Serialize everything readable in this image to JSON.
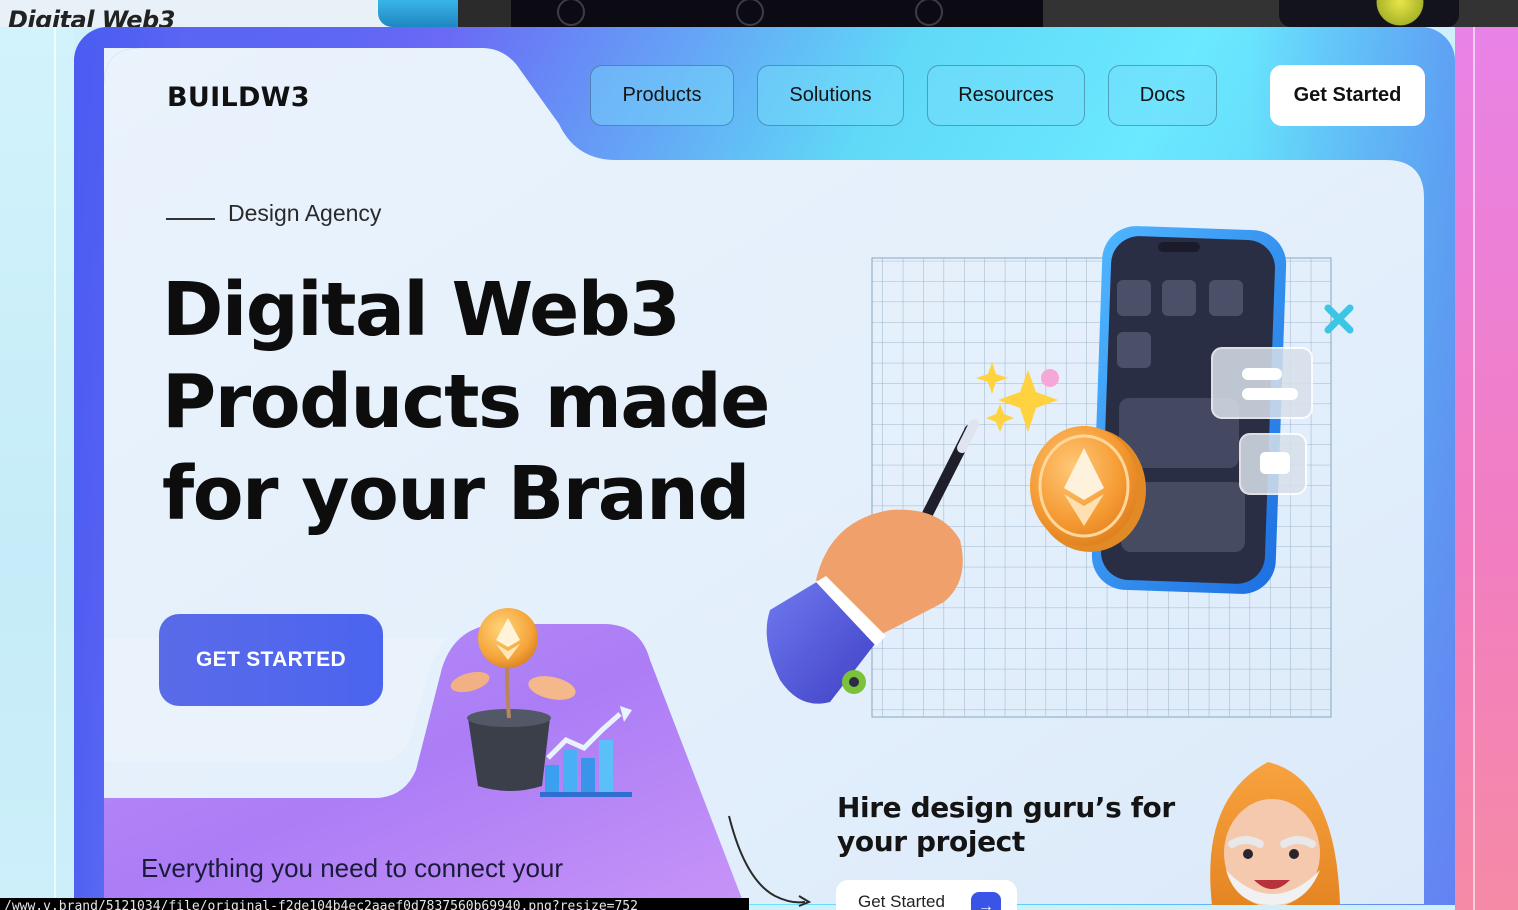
{
  "top_strip": {
    "left_thumb_text": "Digital Web3"
  },
  "header": {
    "logo": "BUILDW3",
    "nav": [
      "Products",
      "Solutions",
      "Resources",
      "Docs"
    ],
    "cta": "Get Started"
  },
  "hero": {
    "eyebrow": "Design Agency",
    "title_line1_pre": "Digital",
    "title_line1_highlight": "Web3",
    "title_line2": "Products made",
    "title_line3": "for your Brand",
    "cta": "GET STARTED"
  },
  "feature_card": {
    "text": "Everything you need to connect your"
  },
  "hire_card": {
    "title": "Hire design guru’s for your project",
    "button": "Get Started",
    "button_icon": "arrow-right-icon"
  },
  "status_bar": {
    "url": "/www.v.brand/5121034/file/original-f2de104b4ec2aaef0d7837560b69940.png?resize=752"
  },
  "colors": {
    "accent_blue": "#4b64ef",
    "frame_cyan": "#6ae9ff",
    "highlight_green": "#aaf564",
    "panel_light": "#e6f1fb"
  }
}
